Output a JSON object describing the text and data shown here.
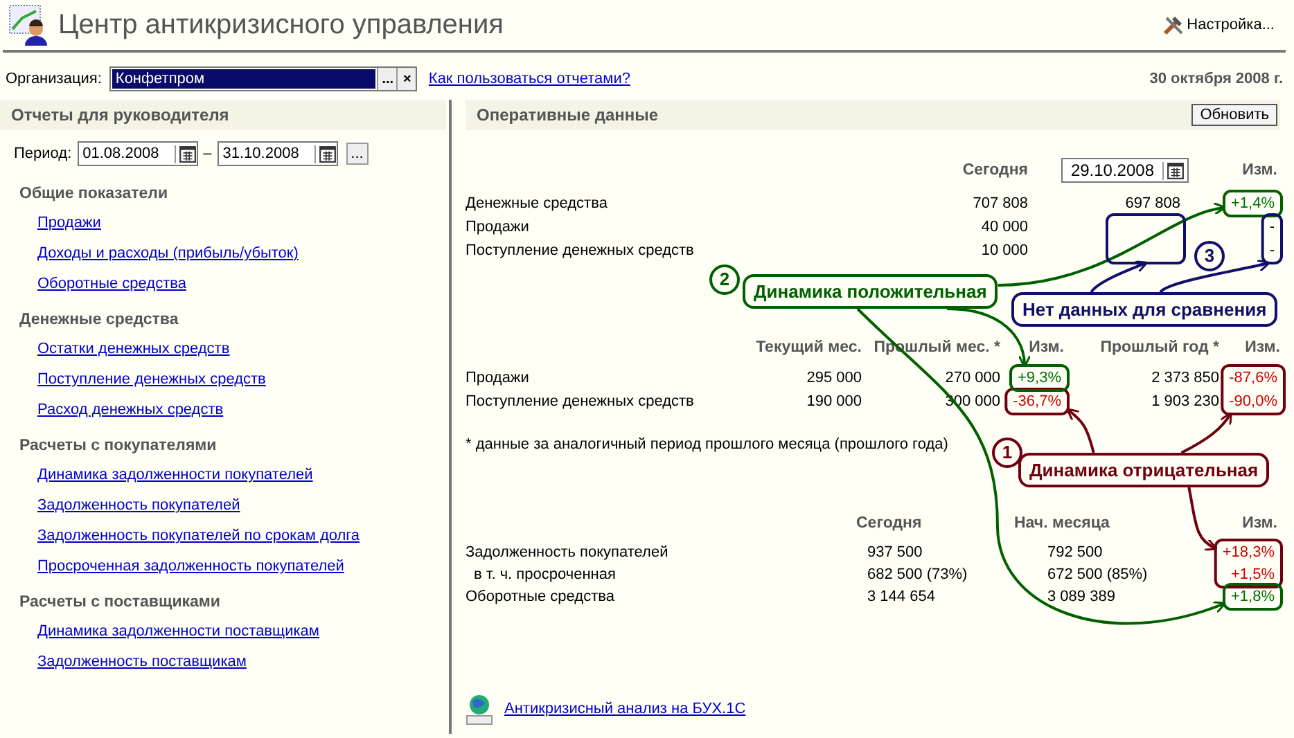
{
  "window": {
    "title": "Центр антикризисного управления",
    "settings_button": "Настройка..."
  },
  "organization": {
    "label": "Организация:",
    "value": "Конфетпром",
    "select_button": "...",
    "clear_button": "×",
    "help_link": "Как пользоваться отчетами?",
    "date": "30 октября 2008 г."
  },
  "reports": {
    "title": "Отчеты для руководителя",
    "period_label": "Период:",
    "period_from": "01.08.2008",
    "period_dash": "–",
    "period_to": "31.10.2008",
    "period_button": "...",
    "groups": [
      {
        "title": "Общие показатели",
        "links": [
          "Продажи",
          "Доходы и расходы (прибыль/убыток)",
          "Оборотные средства"
        ]
      },
      {
        "title": "Денежные средства",
        "links": [
          "Остатки денежных средств",
          "Поступление денежных средств",
          "Расход денежных средств"
        ]
      },
      {
        "title": "Расчеты с покупателями",
        "links": [
          "Динамика задолженности покупателей",
          "Задолженность покупателей",
          "Задолженность покупателей по срокам долга",
          "Просроченная задолженность покупателей"
        ]
      },
      {
        "title": "Расчеты с поставщиками",
        "links": [
          "Динамика задолженности поставщикам",
          "Задолженность поставщикам"
        ]
      }
    ]
  },
  "operational": {
    "title": "Оперативные данные",
    "refresh_button": "Обновить",
    "table_1": {
      "col_today": "Сегодня",
      "compare_date": "29.10.2008",
      "col_change": "Изм.",
      "rows": [
        {
          "name": "Денежные средства",
          "today": "707 808",
          "compare": "697 808",
          "change": {
            "text": "+1,4%",
            "color": "#007000"
          }
        },
        {
          "name": "Продажи",
          "today": "40 000",
          "change": {
            "text": "-",
            "color": "#000000"
          }
        },
        {
          "name": "Поступление денежных средств",
          "today": "10 000",
          "change": {
            "text": "-",
            "color": "#000000"
          }
        }
      ]
    },
    "table_2": {
      "columns": [
        "Текущий мес.",
        "Прошлый мес. *",
        "Изм.",
        "Прошлый год *",
        "Изм."
      ],
      "rows": [
        {
          "name": "Продажи",
          "current": "295 000",
          "last_month": "270 000",
          "change_month": {
            "text": "+9,3%",
            "color": "#007000"
          },
          "last_year": "2 373 850",
          "change_year": {
            "text": "-87,6%",
            "color": "#cc0000"
          }
        },
        {
          "name": "Поступление денежных средств",
          "current": "190 000",
          "last_month": "300 000",
          "change_month": {
            "text": "-36,7%",
            "color": "#cc0000"
          },
          "last_year": "1 903 230",
          "change_year": {
            "text": "-90,0%",
            "color": "#cc0000"
          }
        }
      ]
    },
    "footnote": "* данные за аналогичный период прошлого месяца (прошлого года)",
    "table_3": {
      "columns": [
        "Сегодня",
        "Нач. месяца",
        "Изм."
      ],
      "rows": [
        {
          "name": "Задолженность покупателей",
          "indent": false,
          "today": "937 500",
          "month_start": "792 500",
          "change": {
            "text": "+18,3%",
            "color": "#cc0000"
          }
        },
        {
          "name": "в т. ч. просроченная",
          "indent": true,
          "today": "682 500 (73%)",
          "month_start": "672 500 (85%)",
          "change": {
            "text": "+1,5%",
            "color": "#cc0000"
          }
        },
        {
          "name": "Оборотные средства",
          "indent": false,
          "today": "3 144 654",
          "month_start": "3 089 389",
          "change": {
            "text": "+1,8%",
            "color": "#007000"
          }
        }
      ]
    },
    "web_link": "Антикризисный анализ на БУХ.1С"
  },
  "annotations": [
    {
      "kind": "negative",
      "number": "1",
      "label": "Динамика отрицательная"
    },
    {
      "kind": "positive",
      "number": "2",
      "label": "Динамика положительная"
    },
    {
      "kind": "nodata",
      "number": "3",
      "label": "Нет данных для сравнения"
    }
  ]
}
